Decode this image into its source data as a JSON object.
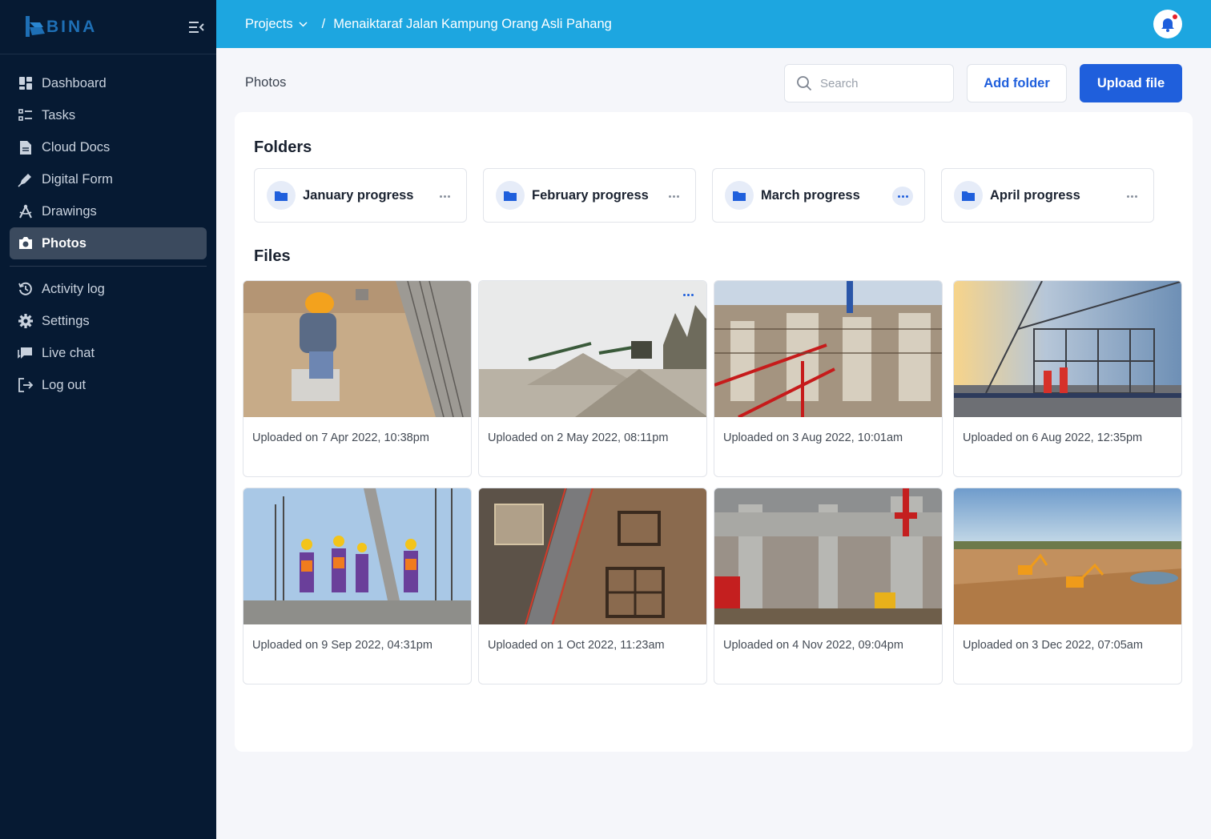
{
  "app": {
    "logo_text": "BINA"
  },
  "sidebar": {
    "items": [
      {
        "label": "Dashboard",
        "icon": "dashboard-icon"
      },
      {
        "label": "Tasks",
        "icon": "tasks-icon"
      },
      {
        "label": "Cloud Docs",
        "icon": "document-icon"
      },
      {
        "label": "Digital Form",
        "icon": "pen-icon"
      },
      {
        "label": "Drawings",
        "icon": "drafting-icon"
      },
      {
        "label": "Photos",
        "icon": "camera-icon",
        "active": true
      }
    ],
    "secondary": [
      {
        "label": "Activity log",
        "icon": "history-icon"
      },
      {
        "label": "Settings",
        "icon": "gear-icon"
      },
      {
        "label": "Live chat",
        "icon": "chat-icon"
      },
      {
        "label": "Log out",
        "icon": "logout-icon"
      }
    ]
  },
  "topbar": {
    "breadcrumb_root": "Projects",
    "separator": "/",
    "breadcrumb_current": "Menaiktaraf Jalan Kampung Orang Asli Pahang"
  },
  "header": {
    "title": "Photos",
    "search_placeholder": "Search",
    "add_folder_label": "Add folder",
    "upload_label": "Upload file"
  },
  "folders_section": {
    "title": "Folders",
    "items": [
      {
        "name": "January progress"
      },
      {
        "name": "February progress"
      },
      {
        "name": "March progress"
      },
      {
        "name": "April progress"
      }
    ]
  },
  "files_section": {
    "title": "Files",
    "items": [
      {
        "caption": "Uploaded on 7 Apr 2022, 10:38pm"
      },
      {
        "caption": "Uploaded on 2 May 2022, 08:11pm"
      },
      {
        "caption": "Uploaded on 3 Aug 2022, 10:01am"
      },
      {
        "caption": "Uploaded on 6 Aug 2022, 12:35pm"
      },
      {
        "caption": "Uploaded on 9 Sep 2022, 04:31pm"
      },
      {
        "caption": "Uploaded on 1 Oct 2022, 11:23am"
      },
      {
        "caption": "Uploaded on 4 Nov 2022, 09:04pm"
      },
      {
        "caption": "Uploaded on 3 Dec 2022, 07:05am"
      }
    ]
  },
  "colors": {
    "sidebar_bg": "#061a33",
    "topbar_bg": "#1da6e0",
    "primary": "#1f5fdc"
  }
}
